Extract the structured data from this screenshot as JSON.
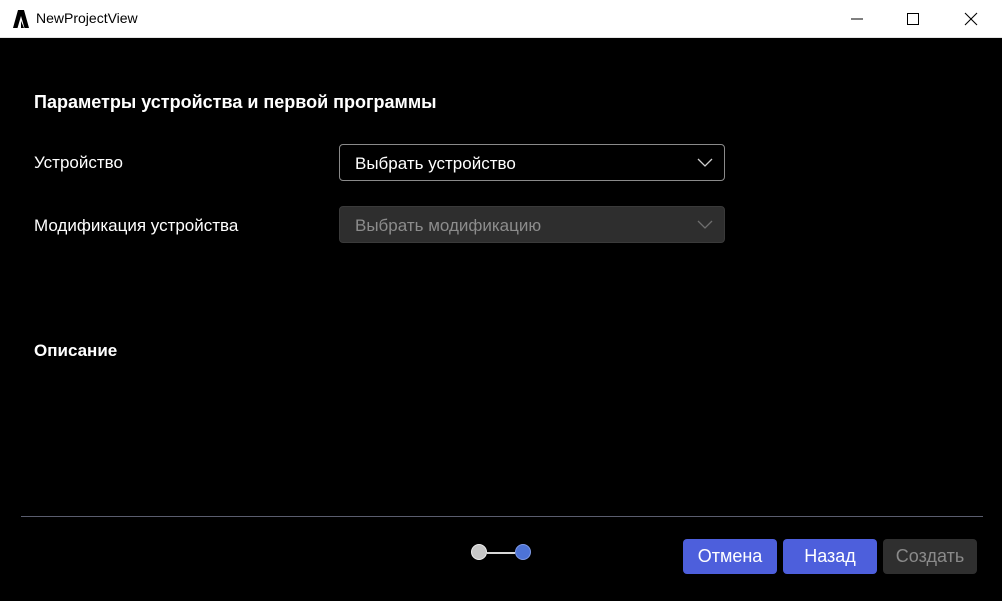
{
  "window": {
    "title": "NewProjectView",
    "app_icon": "app-logo-icon",
    "controls": [
      "minimize-icon",
      "maximize-icon",
      "close-icon"
    ]
  },
  "form": {
    "section_title": "Параметры устройства и первой программы",
    "device": {
      "label": "Устройство",
      "placeholder": "Выбрать устройство",
      "enabled": true
    },
    "modification": {
      "label": "Модификация устройства",
      "placeholder": "Выбрать модификацию",
      "enabled": false
    },
    "description_title": "Описание"
  },
  "stepper": {
    "total_steps": 2,
    "current_step": 2
  },
  "footer": {
    "cancel_label": "Отмена",
    "back_label": "Назад",
    "create_label": "Создать",
    "create_enabled": false
  },
  "colors": {
    "background": "#000000",
    "accent": "#4d5fdc",
    "step_active": "#4d73d6",
    "disabled": "#2f2f2f"
  }
}
